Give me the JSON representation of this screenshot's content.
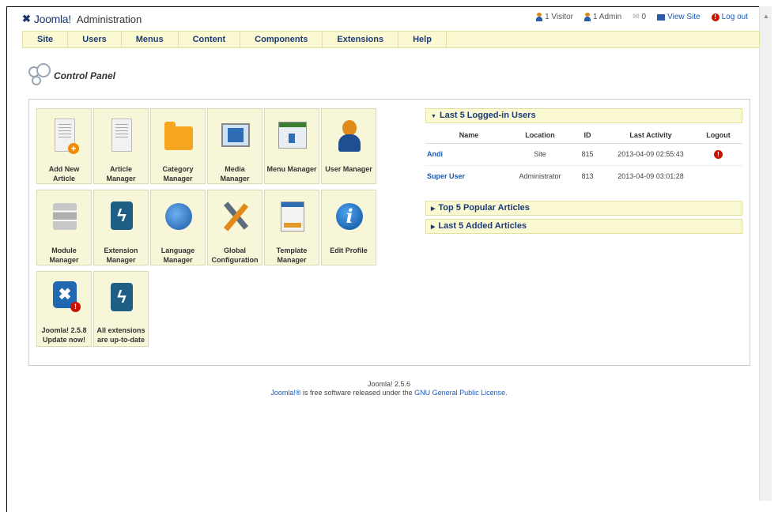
{
  "header": {
    "logo_mark": "✖",
    "logo_name": "Joomla!",
    "admin_label": "Administration",
    "status": {
      "visitors": "1 Visitor",
      "admins": "1 Admin",
      "messages": "0",
      "view_site": "View Site",
      "logout": "Log out"
    }
  },
  "menu": [
    "Site",
    "Users",
    "Menus",
    "Content",
    "Components",
    "Extensions",
    "Help"
  ],
  "page_title": "Control Panel",
  "tiles": [
    {
      "label": "Add New Article",
      "icon": "add-article-icon"
    },
    {
      "label": "Article Manager",
      "icon": "article-manager-icon"
    },
    {
      "label": "Category Manager",
      "icon": "folder-icon"
    },
    {
      "label": "Media Manager",
      "icon": "media-icon"
    },
    {
      "label": "Menu Manager",
      "icon": "menu-icon"
    },
    {
      "label": "User Manager",
      "icon": "user-icon"
    },
    {
      "label": "Module Manager",
      "icon": "module-icon"
    },
    {
      "label": "Extension Manager",
      "icon": "extension-icon"
    },
    {
      "label": "Language Manager",
      "icon": "globe-icon"
    },
    {
      "label": "Global Configuration",
      "icon": "tools-icon"
    },
    {
      "label": "Template Manager",
      "icon": "template-icon"
    },
    {
      "label": "Edit Profile",
      "icon": "info-icon"
    },
    {
      "label": "Joomla! 2.5.8 Update now!",
      "icon": "joomla-update-icon"
    },
    {
      "label": "All extensions are up-to-date",
      "icon": "extension-icon"
    }
  ],
  "panels": {
    "logged_in": "Last 5 Logged-in Users",
    "popular": "Top 5 Popular Articles",
    "added": "Last 5 Added Articles"
  },
  "users_table": {
    "headers": [
      "Name",
      "Location",
      "ID",
      "Last Activity",
      "Logout"
    ],
    "rows": [
      {
        "name": "Andi",
        "location": "Site",
        "id": "815",
        "last": "2013-04-09 02:55:43",
        "logout": "!"
      },
      {
        "name": "Super User",
        "location": "Administrator",
        "id": "813",
        "last": "2013-04-09 03:01:28",
        "logout": ""
      }
    ]
  },
  "footer": {
    "version": "Joomla! 2.5.6",
    "line_prefix": "Joomla!®",
    "line_middle": " is free software released under the ",
    "license": "GNU General Public License",
    "line_suffix": "."
  },
  "colors": {
    "menu_bg": "#fbf9d2",
    "tile_bg": "#f7f6d9",
    "link": "#1a5ab7",
    "nav_text": "#1a3a78"
  }
}
